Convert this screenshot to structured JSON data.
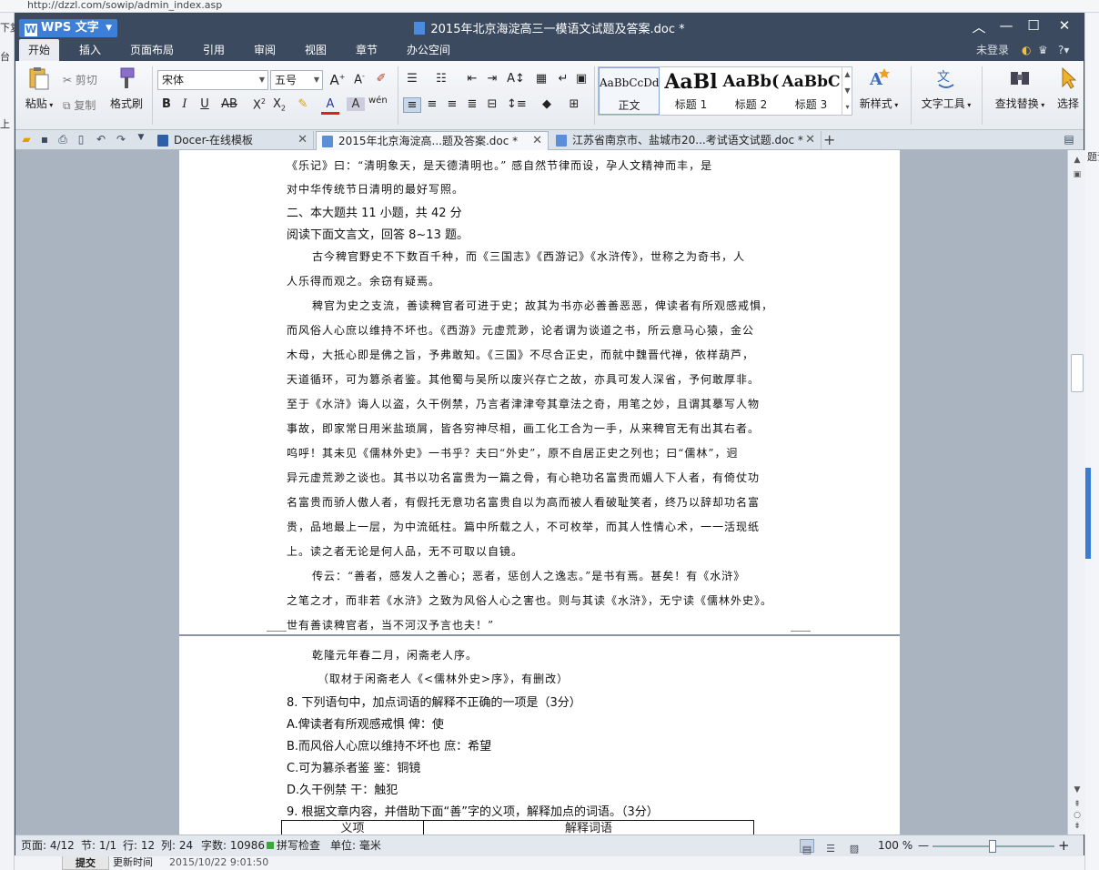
{
  "background": {
    "url_fragment": "http://dzzl.com/sowip/admin_index.asp",
    "left_fragments": [
      "下复",
      "台",
      "上"
    ],
    "right_fragment": "题设",
    "submit_label": "提交",
    "updated_label": "更新时间",
    "updated_value": "2015/10/22 9:01:50"
  },
  "titlebar": {
    "app_name": "WPS 文字",
    "document_title": "2015年北京海淀高三一模语文试题及答案.doc *"
  },
  "menubar": {
    "tabs": [
      "开始",
      "插入",
      "页面布局",
      "引用",
      "审阅",
      "视图",
      "章节",
      "办公空间"
    ],
    "active_tab": "开始",
    "login_status": "未登录"
  },
  "ribbon": {
    "paste_label": "粘贴",
    "cut_label": "剪切",
    "copy_label": "复制",
    "format_painter_label": "格式刷",
    "font_name": "宋体",
    "font_size": "五号",
    "styles": [
      {
        "sample": "AaBbCcDd",
        "name": "正文"
      },
      {
        "sample": "AaBl",
        "name": "标题 1"
      },
      {
        "sample": "AaBb(",
        "name": "标题 2"
      },
      {
        "sample": "AaBbC",
        "name": "标题 3"
      }
    ],
    "new_style_label": "新样式",
    "text_tools_label": "文字工具",
    "find_replace_label": "查找替换",
    "select_label": "选择"
  },
  "tabs": [
    {
      "label": "Docer-在线模板",
      "active": false
    },
    {
      "label": "2015年北京海淀高...题及答案.doc *",
      "active": true
    },
    {
      "label": "江苏省南京市、盐城市20...考试语文试题.doc *",
      "active": false
    }
  ],
  "document": {
    "page1_lines": [
      "《乐记》曰：“清明象天，是天德清明也。” 感自然节律而设，孕人文精神而丰，是",
      "对中华传统节日清明的最好写照。",
      "二、本大题共 11 小题，共 42 分",
      "阅读下面文言文，回答 8~13 题。",
      "古今稗官野史不下数百千种，而《三国志》《西游记》《水浒传》，世称之为奇书，人",
      "人乐得而观之。余窃有疑焉。",
      "稗官为史之支流，善读稗官者可进于史；故其为书亦必善善恶恶，俾读者有所观感戒惧，",
      "而风俗人心庶以维持不坏也。《西游》元虚荒渺，论者谓为谈道之书，所云意马心猿，金公",
      "木母，大抵心即是佛之旨，予弗敢知。《三国》不尽合正史，而就中魏晋代禅，依样葫芦，",
      "天道循环，可为篡杀者鉴。其他蜀与吴所以废兴存亡之故，亦具可发人深省，予何敢厚非。",
      "至于《水浒》诲人以盗，久干例禁，乃言者津津夸其章法之奇，用笔之妙，且谓其摹写人物",
      "事故，即家常日用米盐琐屑，皆各穷神尽相，画工化工合为一手，从来稗官无有出其右者。",
      "呜呼！其未见《儒林外史》一书乎？夫曰“外史”，原不自居正史之列也；曰“儒林”，迥",
      "异元虚荒渺之谈也。其书以功名富贵为一篇之骨，有心艳功名富贵而媚人下人者，有倚仗功",
      "名富贵而骄人傲人者，有假托无意功名富贵自以为高而被人看破耻笑者，终乃以辞却功名富",
      "贵，品地最上一层，为中流砥柱。篇中所载之人，不可枚举，而其人性情心术，一一活现纸",
      "上。读之者无论是何人品，无不可取以自镜。",
      "传云：“善者，感发人之善心；恶者，惩创人之逸志。”是书有焉。甚矣！有《水浒》",
      "之笔之才，而非若《水浒》之致为风俗人心之害也。则与其读《水浒》，无宁读《儒林外史》。",
      "世有善读稗官者，当不河汉予言也夫！”"
    ],
    "page2_lines": [
      "乾隆元年春二月，闲斋老人序。",
      "（取材于闲斋老人《<儒林外史>序》，有删改）",
      "8. 下列语句中，加点词语的解释不正确的一项是（3分）",
      "A.俾读者有所观感戒惧 俾：使",
      "B.而风俗人心庶以维持不坏也 庶：希望",
      "C.可为篡杀者鉴 鉴：铜镜",
      "D.久干例禁 干：触犯",
      "9. 根据文章内容，并借助下面“善”字的义项，解释加点的词语。（3分）"
    ],
    "table_headers": [
      "义项",
      "解释词语"
    ]
  },
  "statusbar": {
    "page": "页面: 4/12",
    "section": "节: 1/1",
    "row": "行: 12",
    "col": "列: 24",
    "word_count": "字数: 10986",
    "spellcheck": "拼写检查",
    "unit": "单位: 毫米",
    "zoom": "100 %"
  }
}
